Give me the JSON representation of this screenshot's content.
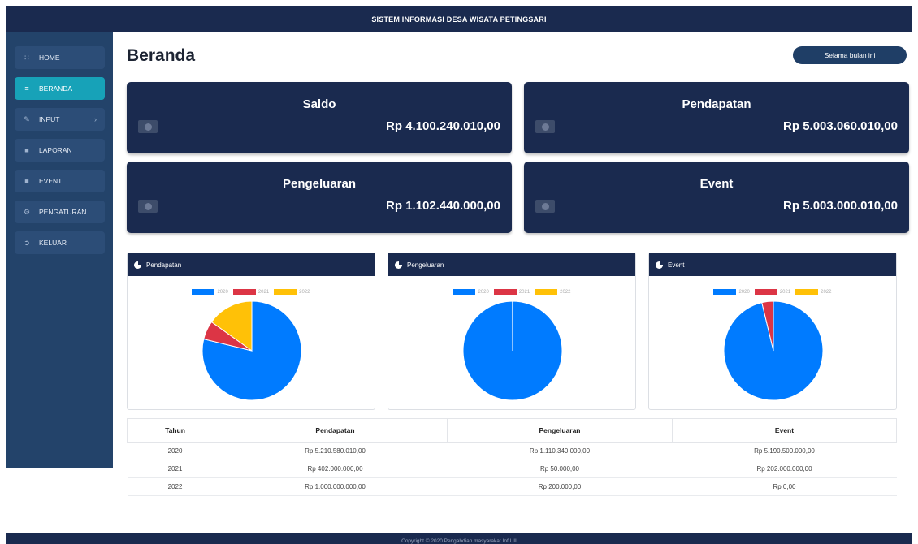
{
  "header": {
    "title": "SISTEM INFORMASI DESA WISATA PETINGSARI"
  },
  "sidebar": {
    "items": [
      {
        "label": "HOME",
        "icon": "grid-icon",
        "active": false
      },
      {
        "label": "BERANDA",
        "icon": "layers-icon",
        "active": true
      },
      {
        "label": "INPUT",
        "icon": "edit-icon",
        "active": false,
        "has_submenu": true
      },
      {
        "label": "LAPORAN",
        "icon": "book-icon",
        "active": false
      },
      {
        "label": "EVENT",
        "icon": "book-icon",
        "active": false
      },
      {
        "label": "PENGATURAN",
        "icon": "cogs-icon",
        "active": false
      },
      {
        "label": "KELUAR",
        "icon": "sign-out-icon",
        "active": false
      }
    ]
  },
  "page": {
    "title": "Beranda",
    "period_button": "Selama bulan ini"
  },
  "summary_cards": [
    {
      "title": "Saldo",
      "value": "Rp 4.100.240.010,00"
    },
    {
      "title": "Pendapatan",
      "value": "Rp 5.003.060.010,00"
    },
    {
      "title": "Pengeluaran",
      "value": "Rp 1.102.440.000,00"
    },
    {
      "title": "Event",
      "value": "Rp 5.003.000.010,00"
    }
  ],
  "colors": {
    "navy": "#1a2a4f",
    "sidebar": "#23436a",
    "active": "#17a2b8",
    "c2020": "#007bff",
    "c2021": "#dc3545",
    "c2022": "#ffc107"
  },
  "chart_panels": [
    {
      "title": "Pendapatan"
    },
    {
      "title": "Pengeluaran"
    },
    {
      "title": "Event"
    }
  ],
  "chart_data": [
    {
      "type": "pie",
      "title": "Pendapatan",
      "labels": [
        "2020",
        "2021",
        "2022"
      ],
      "values": [
        5210580010,
        402000000,
        1000000000
      ]
    },
    {
      "type": "pie",
      "title": "Pengeluaran",
      "labels": [
        "2020",
        "2021",
        "2022"
      ],
      "values": [
        1110340000,
        50000,
        200000
      ]
    },
    {
      "type": "pie",
      "title": "Event",
      "labels": [
        "2020",
        "2021",
        "2022"
      ],
      "values": [
        5190500000,
        202000000,
        0
      ]
    }
  ],
  "table": {
    "headers": [
      "Tahun",
      "Pendapatan",
      "Pengeluaran",
      "Event"
    ],
    "rows": [
      [
        "2020",
        "Rp 5.210.580.010,00",
        "Rp 1.110.340.000,00",
        "Rp 5.190.500.000,00"
      ],
      [
        "2021",
        "Rp 402.000.000,00",
        "Rp 50.000,00",
        "Rp 202.000.000,00"
      ],
      [
        "2022",
        "Rp 1.000.000.000,00",
        "Rp 200.000,00",
        "Rp 0,00"
      ]
    ]
  },
  "footer": {
    "text": "Copyright © 2020 Pengabdian masyarakat Inf UII"
  }
}
